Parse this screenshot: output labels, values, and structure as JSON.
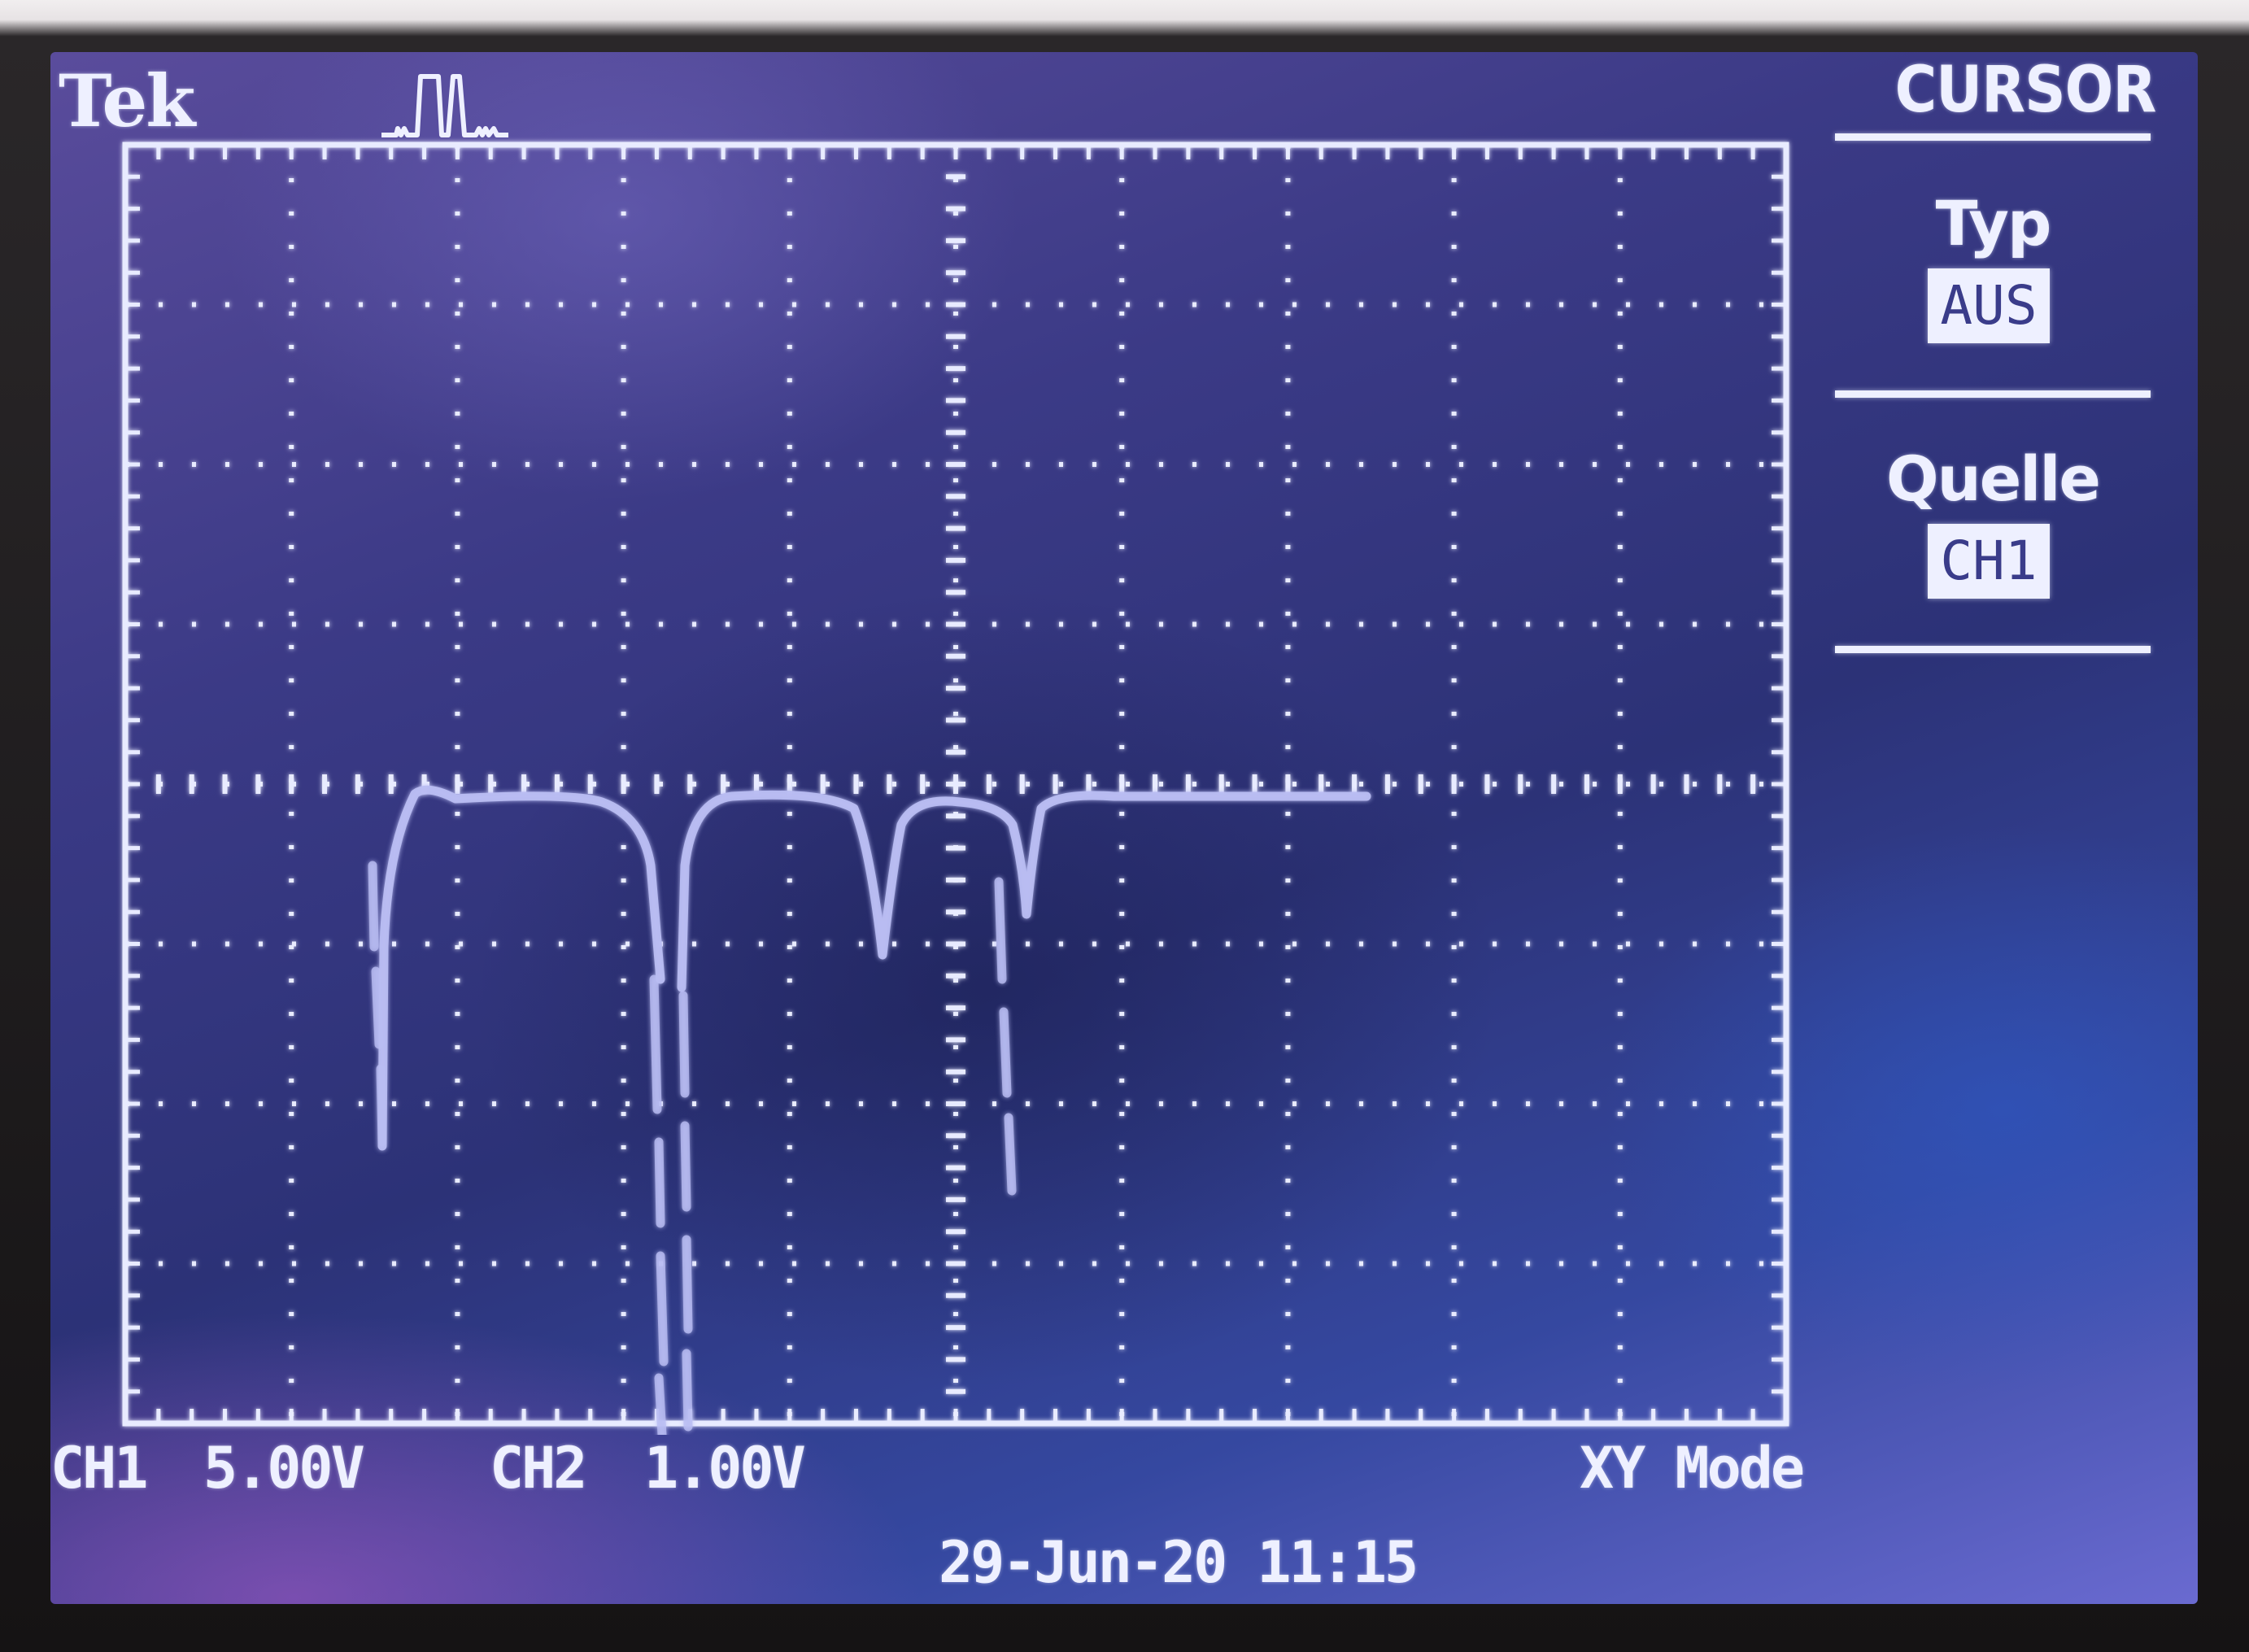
{
  "header": {
    "brand": "Tek"
  },
  "menu": {
    "title": "CURSOR",
    "items": [
      {
        "label": "Typ",
        "value": "AUS"
      },
      {
        "label": "Quelle",
        "value": "CH1"
      }
    ]
  },
  "status": {
    "ch1_label": "CH1",
    "ch1_scale": "5.00V",
    "ch2_label": "CH2",
    "ch2_scale": "1.00V",
    "mode": "XY Mode",
    "datetime": "29-Jun-20 11:15"
  },
  "colors": {
    "screen_bg": "#3b3a86",
    "osd_text": "#eef0ff",
    "trace": "#b9bdf2"
  }
}
